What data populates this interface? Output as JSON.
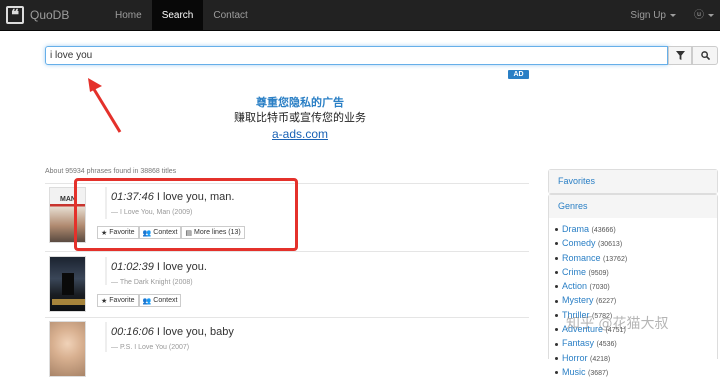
{
  "brand": {
    "name": "QuoDB"
  },
  "nav": {
    "items": [
      {
        "label": "Home",
        "active": false
      },
      {
        "label": "Search",
        "active": true
      },
      {
        "label": "Contact",
        "active": false
      }
    ],
    "signup": "Sign Up",
    "user": "ⓤ"
  },
  "search": {
    "value": "i love you"
  },
  "ad": {
    "badge": "AD",
    "title": "尊重您隐私的广告",
    "subtitle": "赚取比特币或宣传您的业务",
    "link": "a-ads.com"
  },
  "results_count": "About 95934 phrases found in 38868 titles",
  "results": [
    {
      "time": "01:37:46",
      "line": "I love you, man.",
      "source": "— I Love You, Man (2009)",
      "buttons": [
        "Favorite",
        "Context",
        "More lines (13)"
      ]
    },
    {
      "time": "01:02:39",
      "line": "I love you.",
      "source": "— The Dark Knight (2008)",
      "buttons": [
        "Favorite",
        "Context"
      ]
    },
    {
      "time": "00:16:06",
      "line": "I love you, baby",
      "source": "— P.S. I Love You (2007)",
      "buttons": []
    }
  ],
  "sidebar": {
    "favorites": "Favorites",
    "genres_title": "Genres",
    "genres": [
      {
        "name": "Drama",
        "count": "(43666)"
      },
      {
        "name": "Comedy",
        "count": "(30613)"
      },
      {
        "name": "Romance",
        "count": "(13762)"
      },
      {
        "name": "Crime",
        "count": "(9509)"
      },
      {
        "name": "Action",
        "count": "(7030)"
      },
      {
        "name": "Mystery",
        "count": "(6227)"
      },
      {
        "name": "Thriller",
        "count": "(5782)"
      },
      {
        "name": "Adventure",
        "count": "(4751)"
      },
      {
        "name": "Fantasy",
        "count": "(4536)"
      },
      {
        "name": "Horror",
        "count": "(4218)"
      },
      {
        "name": "Music",
        "count": "(3687)"
      }
    ]
  },
  "watermark": "知乎 @花猫大叔",
  "colors": {
    "accent": "#2a7fc5",
    "annotation": "#e4312b",
    "navbar": "#222222"
  }
}
